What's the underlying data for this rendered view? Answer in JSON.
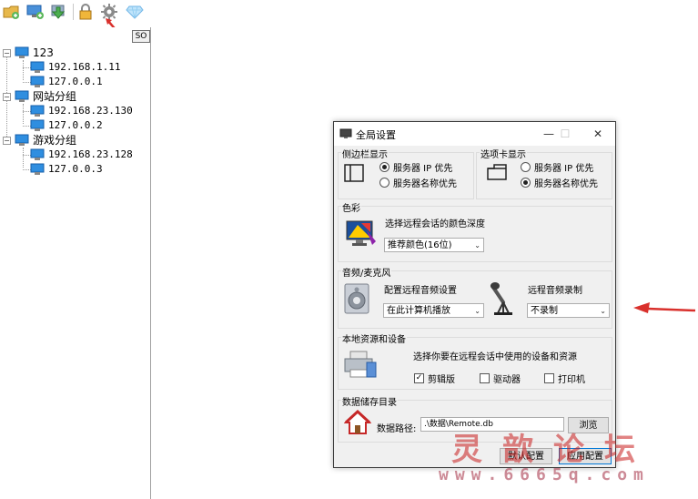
{
  "toolbar": {
    "buttons": [
      "add-folder-icon",
      "add-remote-icon",
      "import-icon",
      "lock-icon",
      "settings-gear-icon",
      "diamond-icon"
    ]
  },
  "tree": {
    "so_button": "SO",
    "groups": [
      {
        "label": "123",
        "hosts": [
          "192.168.1.11",
          "127.0.0.1"
        ]
      },
      {
        "label": "网站分组",
        "hosts": [
          "192.168.23.130",
          "127.0.0.2"
        ]
      },
      {
        "label": "游戏分组",
        "hosts": [
          "192.168.23.128",
          "127.0.0.3"
        ]
      }
    ]
  },
  "dialog": {
    "title": "全局设置",
    "sidebar": {
      "title": "侧边栏显示",
      "options": [
        "服务器 IP 优先",
        "服务器名称优先"
      ],
      "selected": 0
    },
    "tab": {
      "title": "选项卡显示",
      "options": [
        "服务器 IP 优先",
        "服务器名称优先"
      ],
      "selected": 1
    },
    "color": {
      "title": "色彩",
      "label": "选择远程会话的颜色深度",
      "value": "推荐颜色(16位)"
    },
    "audio": {
      "title": "音频/麦克风",
      "playback_label": "配置远程音频设置",
      "playback_value": "在此计算机播放",
      "record_label": "远程音频录制",
      "record_value": "不录制"
    },
    "local": {
      "title": "本地资源和设备",
      "label": "选择你要在远程会话中使用的设备和资源",
      "items": [
        {
          "label": "剪辑版",
          "checked": true
        },
        {
          "label": "驱动器",
          "checked": false
        },
        {
          "label": "打印机",
          "checked": false
        }
      ]
    },
    "storage": {
      "title": "数据储存目录",
      "label": "数据路径:",
      "value": ".\\数据\\Remote.db",
      "browse": "浏览"
    },
    "buttons": {
      "default": "默认配置",
      "apply": "应用配置"
    }
  },
  "watermark": {
    "title": "灵歆论坛",
    "url": "www.6665q.com"
  },
  "colors": {
    "annotation_red": "#d9302c",
    "accent": "#0078d7"
  }
}
